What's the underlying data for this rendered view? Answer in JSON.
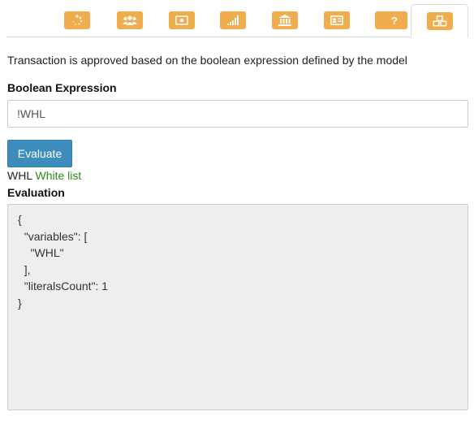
{
  "tabs": [
    {
      "icon": "spinner-icon",
      "active": false
    },
    {
      "icon": "users-icon",
      "active": false
    },
    {
      "icon": "money-icon",
      "active": false
    },
    {
      "icon": "signal-icon",
      "active": false
    },
    {
      "icon": "bank-icon",
      "active": false
    },
    {
      "icon": "id-card-icon",
      "active": false
    },
    {
      "icon": "thumbs-up-icon",
      "active": false
    },
    {
      "icon": "question-icon",
      "active": false
    },
    {
      "icon": "cubes-icon",
      "active": true
    }
  ],
  "colors": {
    "tab_icon": "#f0ad4e",
    "button": "#3c8dbc",
    "variable_description": "#2e8b1e",
    "result_background": "#eeeeee"
  },
  "description": "Transaction is approved based on the boolean expression defined by the model",
  "expression": {
    "label": "Boolean Expression",
    "value": "!WHL"
  },
  "evaluate_button": "Evaluate",
  "variable": {
    "name": "WHL",
    "description": "White list"
  },
  "evaluation": {
    "label": "Evaluation",
    "result": "{\n  \"variables\": [\n    \"WHL\"\n  ],\n  \"literalsCount\": 1\n}"
  }
}
